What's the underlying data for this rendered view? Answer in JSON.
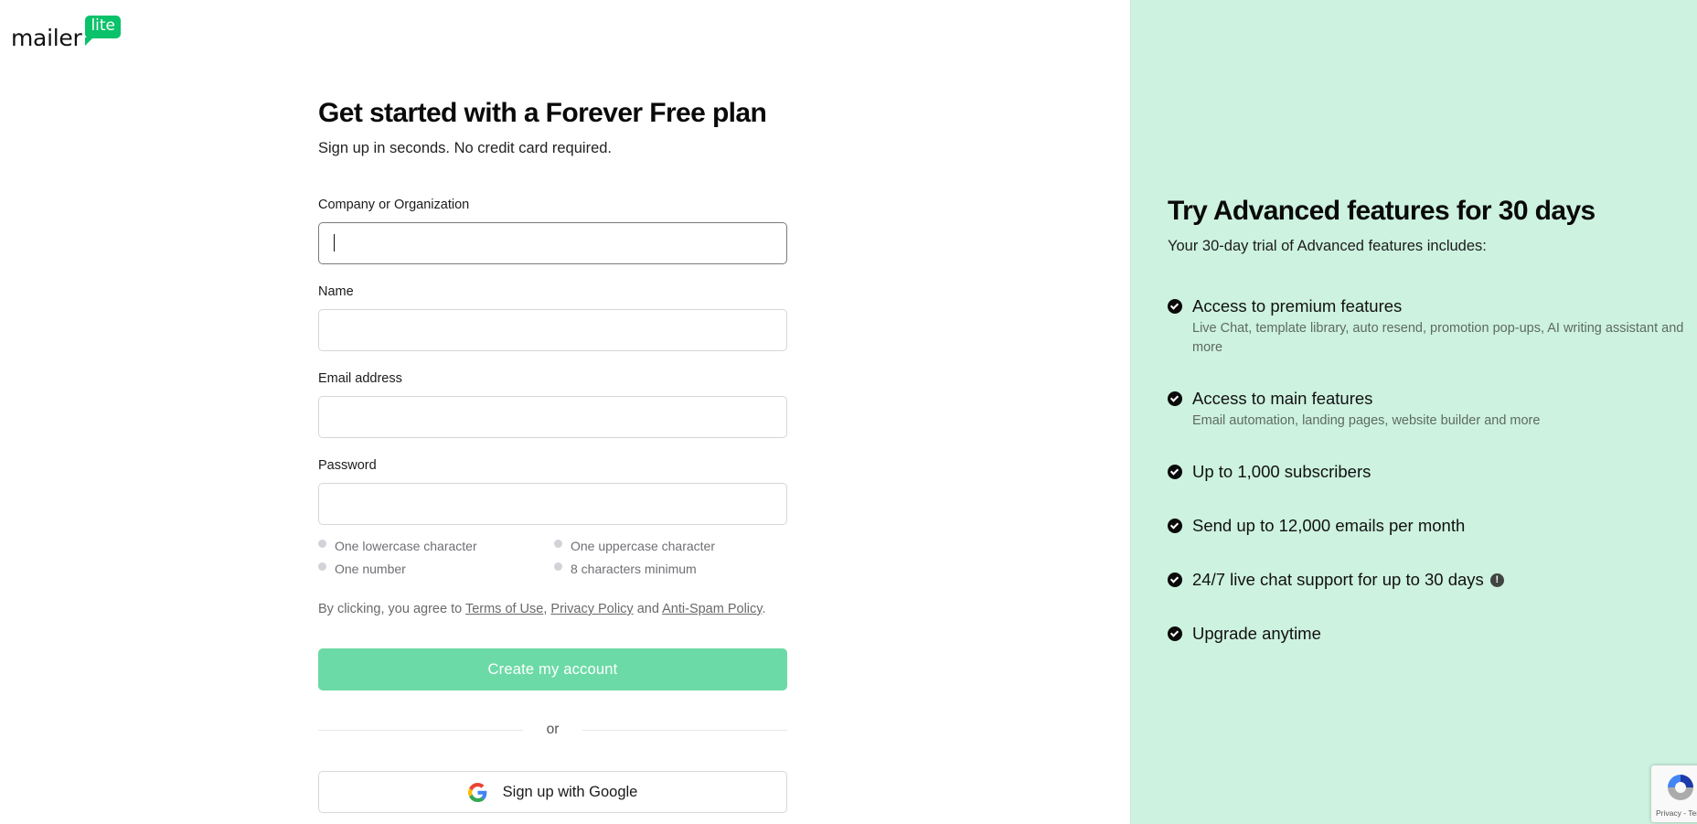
{
  "brand": {
    "wordmark": "mailer",
    "badge": "lite",
    "accent_color": "#09c269"
  },
  "signup": {
    "title": "Get started with a Forever Free plan",
    "subtitle": "Sign up in seconds. No credit card required.",
    "fields": [
      {
        "label": "Company or Organization",
        "value": "",
        "placeholder": "",
        "focused": true
      },
      {
        "label": "Name",
        "value": "",
        "placeholder": ""
      },
      {
        "label": "Email address",
        "value": "",
        "placeholder": ""
      },
      {
        "label": "Password",
        "value": "",
        "placeholder": ""
      }
    ],
    "password_rules": [
      {
        "label": "One lowercase character",
        "met": false
      },
      {
        "label": "One uppercase character",
        "met": false
      },
      {
        "label": "One number",
        "met": false
      },
      {
        "label": "8 characters minimum",
        "met": false
      }
    ],
    "consent": {
      "prefix": "By clicking, you agree to ",
      "terms": "Terms of Use",
      "sep1": ", ",
      "privacy": "Privacy Policy",
      "sep2": " and ",
      "antispam": "Anti-Spam Policy",
      "suffix": "."
    },
    "create_button": "Create my account",
    "create_button_color": "#6cdaa6",
    "divider_text": "or",
    "google_button": "Sign up with Google"
  },
  "trial": {
    "title": "Try Advanced features for 30 days",
    "subtitle": "Your 30-day trial of Advanced features includes:",
    "panel_color": "#cdf2e0",
    "features": [
      {
        "title": "Access to premium features",
        "description": "Live Chat, template library, auto resend, promotion pop-ups, AI writing assistant and more"
      },
      {
        "title": "Access to main features",
        "description": "Email automation, landing pages, website builder and more"
      },
      {
        "title": "Up to 1,000 subscribers",
        "description": ""
      },
      {
        "title": "Send up to 12,000 emails per month",
        "description": ""
      },
      {
        "title": "24/7 live chat support for up to 30 days",
        "description": "",
        "info_icon": "!"
      },
      {
        "title": "Upgrade anytime",
        "description": ""
      }
    ]
  },
  "recaptcha": {
    "text": "Privacy - Terms"
  }
}
